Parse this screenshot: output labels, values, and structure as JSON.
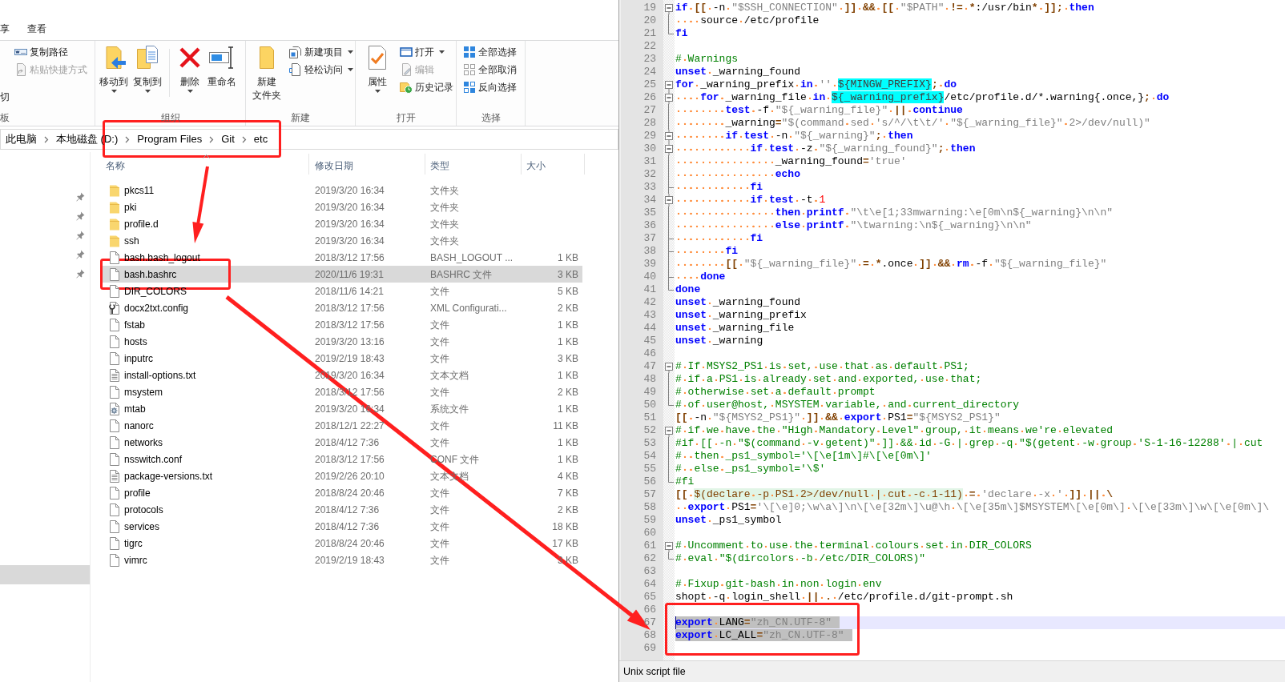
{
  "explorer": {
    "ribbon_tabs": [
      {
        "label": "享",
        "selected": false
      },
      {
        "label": "查看",
        "selected": false
      }
    ],
    "ribbon_groups": [
      {
        "label": "板",
        "columns": [
          [
            {
              "kind": "fragment",
              "label": "切"
            }
          ],
          [
            {
              "kind": "small",
              "label": "复制路径",
              "disabled": false,
              "dropdown": false
            },
            {
              "kind": "small",
              "label": "粘贴快捷方式",
              "disabled": true,
              "dropdown": false
            }
          ]
        ]
      },
      {
        "label": "组织",
        "columns": [
          [
            {
              "kind": "large",
              "label": "移动到",
              "disabled": false,
              "dropdown": true
            }
          ],
          [
            {
              "kind": "large",
              "label": "复制到",
              "disabled": false,
              "dropdown": true
            }
          ],
          [
            {
              "kind": "separator"
            }
          ],
          [
            {
              "kind": "large",
              "label": "删除",
              "disabled": false,
              "dropdown": true
            }
          ],
          [
            {
              "kind": "large",
              "label": "重命名",
              "disabled": false,
              "dropdown": false
            }
          ]
        ]
      },
      {
        "label": "新建",
        "columns": [
          [
            {
              "kind": "large-wrapped",
              "label": "新建文件夹",
              "disabled": false,
              "dropdown": false
            }
          ],
          [
            {
              "kind": "small",
              "label": "新建项目",
              "disabled": false,
              "dropdown": true
            },
            {
              "kind": "small",
              "label": "轻松访问",
              "disabled": false,
              "dropdown": true
            }
          ]
        ]
      },
      {
        "label": "打开",
        "columns": [
          [
            {
              "kind": "large",
              "label": "属性",
              "disabled": false,
              "dropdown": true
            }
          ],
          [
            {
              "kind": "small",
              "label": "打开",
              "disabled": false,
              "dropdown": true
            },
            {
              "kind": "small",
              "label": "编辑",
              "disabled": true,
              "dropdown": false
            },
            {
              "kind": "small",
              "label": "历史记录",
              "disabled": false,
              "dropdown": false
            }
          ]
        ]
      },
      {
        "label": "选择",
        "columns": [
          [
            {
              "kind": "small",
              "label": "全部选择",
              "disabled": false,
              "dropdown": false
            },
            {
              "kind": "small",
              "label": "全部取消",
              "disabled": false,
              "dropdown": false
            },
            {
              "kind": "small",
              "label": "反向选择",
              "disabled": false,
              "dropdown": false
            }
          ]
        ]
      }
    ],
    "address_bar": {
      "path": [
        "此电脑",
        "本地磁盘 (D:)",
        "Program Files",
        "Git",
        "etc"
      ]
    },
    "navigation_pane": {
      "items": [
        {
          "pinned": true,
          "selected": false
        },
        {
          "pinned": true,
          "selected": false
        },
        {
          "pinned": true,
          "selected": false
        },
        {
          "pinned": true,
          "selected": false
        },
        {
          "pinned": true,
          "selected": false
        },
        {
          "pinned": false,
          "selected": true
        }
      ]
    },
    "file_list": {
      "columns": [
        {
          "label": "名称",
          "sorted": true
        },
        {
          "label": "修改日期",
          "sorted": false
        },
        {
          "label": "类型",
          "sorted": false
        },
        {
          "label": "大小",
          "sorted": false
        }
      ],
      "rows": [
        {
          "kind": "folder",
          "name": "pkcs11",
          "modified": "2019/3/20 16:34",
          "type": "文件夹",
          "selected": false
        },
        {
          "kind": "folder",
          "name": "pki",
          "modified": "2019/3/20 16:34",
          "type": "文件夹",
          "selected": false
        },
        {
          "kind": "folder",
          "name": "profile.d",
          "modified": "2019/3/20 16:34",
          "type": "文件夹",
          "selected": false
        },
        {
          "kind": "folder",
          "name": "ssh",
          "modified": "2019/3/20 16:34",
          "type": "文件夹",
          "selected": false
        },
        {
          "kind": "file",
          "name": "bash.bash_logout",
          "modified": "2018/3/12 17:56",
          "type": "BASH_LOGOUT ...",
          "size": "1 KB",
          "selected": false
        },
        {
          "kind": "file",
          "name": "bash.bashrc",
          "modified": "2020/11/6 19:31",
          "type": "BASHRC 文件",
          "size": "3 KB",
          "selected": true
        },
        {
          "kind": "file",
          "name": "DIR_COLORS",
          "modified": "2018/11/6 14:21",
          "type": "文件",
          "size": "5 KB",
          "selected": false
        },
        {
          "kind": "config",
          "name": "docx2txt.config",
          "modified": "2018/3/12 17:56",
          "type": "XML Configurati...",
          "size": "2 KB",
          "selected": false
        },
        {
          "kind": "file",
          "name": "fstab",
          "modified": "2018/3/12 17:56",
          "type": "文件",
          "size": "1 KB",
          "selected": false
        },
        {
          "kind": "file",
          "name": "hosts",
          "modified": "2019/3/20 13:16",
          "type": "文件",
          "size": "1 KB",
          "selected": false
        },
        {
          "kind": "file",
          "name": "inputrc",
          "modified": "2019/2/19 18:43",
          "type": "文件",
          "size": "3 KB",
          "selected": false
        },
        {
          "kind": "text",
          "name": "install-options.txt",
          "modified": "2019/3/20 16:34",
          "type": "文本文档",
          "size": "1 KB",
          "selected": false
        },
        {
          "kind": "file",
          "name": "msystem",
          "modified": "2018/3/12 17:56",
          "type": "文件",
          "size": "2 KB",
          "selected": false
        },
        {
          "kind": "system",
          "name": "mtab",
          "modified": "2019/3/20 16:34",
          "type": "系统文件",
          "size": "1 KB",
          "selected": false
        },
        {
          "kind": "file",
          "name": "nanorc",
          "modified": "2018/12/1 22:27",
          "type": "文件",
          "size": "11 KB",
          "selected": false
        },
        {
          "kind": "file",
          "name": "networks",
          "modified": "2018/4/12 7:36",
          "type": "文件",
          "size": "1 KB",
          "selected": false
        },
        {
          "kind": "file",
          "name": "nsswitch.conf",
          "modified": "2018/3/12 17:56",
          "type": "CONF 文件",
          "size": "1 KB",
          "selected": false
        },
        {
          "kind": "text",
          "name": "package-versions.txt",
          "modified": "2019/2/26 20:10",
          "type": "文本文档",
          "size": "4 KB",
          "selected": false
        },
        {
          "kind": "file",
          "name": "profile",
          "modified": "2018/8/24 20:46",
          "type": "文件",
          "size": "7 KB",
          "selected": false
        },
        {
          "kind": "file",
          "name": "protocols",
          "modified": "2018/4/12 7:36",
          "type": "文件",
          "size": "2 KB",
          "selected": false
        },
        {
          "kind": "file",
          "name": "services",
          "modified": "2018/4/12 7:36",
          "type": "文件",
          "size": "18 KB",
          "selected": false
        },
        {
          "kind": "file",
          "name": "tigrc",
          "modified": "2018/8/24 20:46",
          "type": "文件",
          "size": "17 KB",
          "selected": false
        },
        {
          "kind": "file",
          "name": "vimrc",
          "modified": "2019/2/19 18:43",
          "type": "文件",
          "size": "3 KB",
          "selected": false
        }
      ]
    }
  },
  "editor": {
    "lines": [
      {
        "number": "19",
        "fold": {
          "kind": "open"
        },
        "selected": false,
        "current": false,
        "tokens": [
          {
            "kind": "keyword",
            "text": "if "
          },
          {
            "kind": "operator",
            "text": "[[ "
          },
          {
            "kind": "plain",
            "text": "-n "
          },
          {
            "kind": "string",
            "text": "\"$SSH_CONNECTION\" "
          },
          {
            "kind": "operator",
            "text": "]] && [[ "
          },
          {
            "kind": "string",
            "text": "\"$PATH\" "
          },
          {
            "kind": "operator",
            "text": "!= *"
          },
          {
            "kind": "plain",
            "text": ":/usr/bin"
          },
          {
            "kind": "operator",
            "text": "* ]]; "
          },
          {
            "kind": "keyword",
            "text": "then"
          }
        ]
      },
      {
        "number": "20",
        "fold": {
          "kind": "line"
        },
        "selected": false,
        "current": false,
        "tokens": [
          {
            "kind": "plain",
            "text": "    source /etc/profile"
          }
        ]
      },
      {
        "number": "21",
        "fold": {
          "kind": "end"
        },
        "selected": false,
        "current": false,
        "tokens": [
          {
            "kind": "keyword",
            "text": "fi"
          }
        ]
      },
      {
        "number": "22",
        "selected": false,
        "current": false
      },
      {
        "number": "23",
        "selected": false,
        "current": false,
        "tokens": [
          {
            "kind": "comment",
            "text": "# Warnings"
          }
        ]
      },
      {
        "number": "24",
        "selected": false,
        "current": false,
        "tokens": [
          {
            "kind": "keyword",
            "text": "unset "
          },
          {
            "kind": "plain",
            "text": "_warning_found"
          }
        ]
      },
      {
        "number": "25",
        "fold": {
          "kind": "open"
        },
        "selected": false,
        "current": false,
        "tokens": [
          {
            "kind": "keyword",
            "text": "for "
          },
          {
            "kind": "plain",
            "text": "_warning_prefix "
          },
          {
            "kind": "keyword",
            "text": "in "
          },
          {
            "kind": "string",
            "text": "'' "
          },
          {
            "kind": "param",
            "text": "${MINGW_PREFIX}"
          },
          {
            "kind": "operator",
            "text": "; "
          },
          {
            "kind": "keyword",
            "text": "do"
          }
        ]
      },
      {
        "number": "26",
        "fold": {
          "kind": "nested"
        },
        "selected": false,
        "current": false,
        "tokens": [
          {
            "kind": "keyword",
            "text": "    for "
          },
          {
            "kind": "plain",
            "text": "_warning_file "
          },
          {
            "kind": "keyword",
            "text": "in "
          },
          {
            "kind": "param",
            "text": "${_warning_prefix}"
          },
          {
            "kind": "plain",
            "text": "/etc/profile.d/*.warning{.once,}"
          },
          {
            "kind": "operator",
            "text": "; "
          },
          {
            "kind": "keyword",
            "text": "do"
          }
        ]
      },
      {
        "number": "27",
        "fold": {
          "kind": "line"
        },
        "selected": false,
        "current": false,
        "tokens": [
          {
            "kind": "keyword",
            "text": "        test "
          },
          {
            "kind": "plain",
            "text": "-f "
          },
          {
            "kind": "string",
            "text": "\"${_warning_file}\" "
          },
          {
            "kind": "operator",
            "text": "|| "
          },
          {
            "kind": "keyword",
            "text": "continue"
          }
        ]
      },
      {
        "number": "28",
        "fold": {
          "kind": "line"
        },
        "selected": false,
        "current": false,
        "tokens": [
          {
            "kind": "plain",
            "text": "        _warning"
          },
          {
            "kind": "operator",
            "text": "="
          },
          {
            "kind": "string",
            "text": "\"$(command sed 's/^/\\t\\t/' \"${_warning_file}\" 2>/dev/null)\""
          }
        ]
      },
      {
        "number": "29",
        "fold": {
          "kind": "nested"
        },
        "selected": false,
        "current": false,
        "tokens": [
          {
            "kind": "keyword",
            "text": "        if test "
          },
          {
            "kind": "plain",
            "text": "-n "
          },
          {
            "kind": "string",
            "text": "\"${_warning}\""
          },
          {
            "kind": "operator",
            "text": "; "
          },
          {
            "kind": "keyword",
            "text": "then"
          }
        ]
      },
      {
        "number": "30",
        "fold": {
          "kind": "nested"
        },
        "selected": false,
        "current": false,
        "tokens": [
          {
            "kind": "keyword",
            "text": "            if test "
          },
          {
            "kind": "plain",
            "text": "-z "
          },
          {
            "kind": "string",
            "text": "\"${_warning_found}\""
          },
          {
            "kind": "operator",
            "text": "; "
          },
          {
            "kind": "keyword",
            "text": "then"
          }
        ]
      },
      {
        "number": "31",
        "fold": {
          "kind": "line"
        },
        "selected": false,
        "current": false,
        "tokens": [
          {
            "kind": "plain",
            "text": "                _warning_found"
          },
          {
            "kind": "operator",
            "text": "="
          },
          {
            "kind": "string",
            "text": "'true'"
          }
        ]
      },
      {
        "number": "32",
        "fold": {
          "kind": "line"
        },
        "selected": false,
        "current": false,
        "tokens": [
          {
            "kind": "keyword",
            "text": "                echo"
          }
        ]
      },
      {
        "number": "33",
        "fold": {
          "kind": "tee"
        },
        "selected": false,
        "current": false,
        "tokens": [
          {
            "kind": "keyword",
            "text": "            fi"
          }
        ]
      },
      {
        "number": "34",
        "fold": {
          "kind": "nested"
        },
        "selected": false,
        "current": false,
        "tokens": [
          {
            "kind": "keyword",
            "text": "            if test "
          },
          {
            "kind": "plain",
            "text": "-t "
          },
          {
            "kind": "number",
            "text": "1"
          }
        ]
      },
      {
        "number": "35",
        "fold": {
          "kind": "line"
        },
        "selected": false,
        "current": false,
        "tokens": [
          {
            "kind": "keyword",
            "text": "                then printf "
          },
          {
            "kind": "string",
            "text": "\"\\t\\e[1;33mwarning:\\e[0m\\n${_warning}\\n\\n\""
          }
        ]
      },
      {
        "number": "36",
        "fold": {
          "kind": "line"
        },
        "selected": false,
        "current": false,
        "tokens": [
          {
            "kind": "keyword",
            "text": "                else printf "
          },
          {
            "kind": "string",
            "text": "\"\\twarning:\\n${_warning}\\n\\n\""
          }
        ]
      },
      {
        "number": "37",
        "fold": {
          "kind": "tee"
        },
        "selected": false,
        "current": false,
        "tokens": [
          {
            "kind": "keyword",
            "text": "            fi"
          }
        ]
      },
      {
        "number": "38",
        "fold": {
          "kind": "tee"
        },
        "selected": false,
        "current": false,
        "tokens": [
          {
            "kind": "keyword",
            "text": "        fi"
          }
        ]
      },
      {
        "number": "39",
        "fold": {
          "kind": "line"
        },
        "selected": false,
        "current": false,
        "tokens": [
          {
            "kind": "operator",
            "text": "        [[ "
          },
          {
            "kind": "string",
            "text": "\"${_warning_file}\" "
          },
          {
            "kind": "operator",
            "text": "= *"
          },
          {
            "kind": "plain",
            "text": ".once "
          },
          {
            "kind": "operator",
            "text": "]] && "
          },
          {
            "kind": "keyword",
            "text": "rm "
          },
          {
            "kind": "plain",
            "text": "-f "
          },
          {
            "kind": "string",
            "text": "\"${_warning_file}\""
          }
        ]
      },
      {
        "number": "40",
        "fold": {
          "kind": "tee"
        },
        "selected": false,
        "current": false,
        "tokens": [
          {
            "kind": "keyword",
            "text": "    done"
          }
        ]
      },
      {
        "number": "41",
        "fold": {
          "kind": "end"
        },
        "selected": false,
        "current": false,
        "tokens": [
          {
            "kind": "keyword",
            "text": "done"
          }
        ]
      },
      {
        "number": "42",
        "selected": false,
        "current": false,
        "tokens": [
          {
            "kind": "keyword",
            "text": "unset "
          },
          {
            "kind": "plain",
            "text": "_warning_found"
          }
        ]
      },
      {
        "number": "43",
        "selected": false,
        "current": false,
        "tokens": [
          {
            "kind": "keyword",
            "text": "unset "
          },
          {
            "kind": "plain",
            "text": "_warning_prefix"
          }
        ]
      },
      {
        "number": "44",
        "selected": false,
        "current": false,
        "tokens": [
          {
            "kind": "keyword",
            "text": "unset "
          },
          {
            "kind": "plain",
            "text": "_warning_file"
          }
        ]
      },
      {
        "number": "45",
        "selected": false,
        "current": false,
        "tokens": [
          {
            "kind": "keyword",
            "text": "unset "
          },
          {
            "kind": "plain",
            "text": "_warning"
          }
        ]
      },
      {
        "number": "46",
        "selected": false,
        "current": false
      },
      {
        "number": "47",
        "fold": {
          "kind": "open"
        },
        "selected": false,
        "current": false,
        "tokens": [
          {
            "kind": "comment",
            "text": "# If MSYS2_PS1 is set, use that as default PS1;"
          }
        ]
      },
      {
        "number": "48",
        "fold": {
          "kind": "line"
        },
        "selected": false,
        "current": false,
        "tokens": [
          {
            "kind": "comment",
            "text": "# if a PS1 is already set and exported, use that;"
          }
        ]
      },
      {
        "number": "49",
        "fold": {
          "kind": "line"
        },
        "selected": false,
        "current": false,
        "tokens": [
          {
            "kind": "comment",
            "text": "# otherwise set a default prompt"
          }
        ]
      },
      {
        "number": "50",
        "fold": {
          "kind": "end"
        },
        "selected": false,
        "current": false,
        "tokens": [
          {
            "kind": "comment",
            "text": "# of user@host, MSYSTEM variable, and current_directory"
          }
        ]
      },
      {
        "number": "51",
        "selected": false,
        "current": false,
        "tokens": [
          {
            "kind": "operator",
            "text": "[[ "
          },
          {
            "kind": "plain",
            "text": "-n "
          },
          {
            "kind": "string",
            "text": "\"${MSYS2_PS1}\" "
          },
          {
            "kind": "operator",
            "text": "]] && "
          },
          {
            "kind": "keyword",
            "text": "export "
          },
          {
            "kind": "plain",
            "text": "PS1"
          },
          {
            "kind": "operator",
            "text": "="
          },
          {
            "kind": "string",
            "text": "\"${MSYS2_PS1}\""
          }
        ]
      },
      {
        "number": "52",
        "fold": {
          "kind": "open"
        },
        "selected": false,
        "current": false,
        "tokens": [
          {
            "kind": "comment",
            "text": "# if we have the \"High Mandatory Level\" group, it means we're elevated"
          }
        ]
      },
      {
        "number": "53",
        "fold": {
          "kind": "line"
        },
        "selected": false,
        "current": false,
        "tokens": [
          {
            "kind": "comment",
            "text": "#if [[ -n \"$(command -v getent)\" ]] && id -G | grep -q \"$(getent -w group 'S-1-16-12288' | cut"
          }
        ]
      },
      {
        "number": "54",
        "fold": {
          "kind": "line"
        },
        "selected": false,
        "current": false,
        "tokens": [
          {
            "kind": "comment",
            "text": "#  then _ps1_symbol='\\[\\e[1m\\]#\\[\\e[0m\\]'"
          }
        ]
      },
      {
        "number": "55",
        "fold": {
          "kind": "line"
        },
        "selected": false,
        "current": false,
        "tokens": [
          {
            "kind": "comment",
            "text": "#  else _ps1_symbol='\\$'"
          }
        ]
      },
      {
        "number": "56",
        "fold": {
          "kind": "end"
        },
        "selected": false,
        "current": false,
        "tokens": [
          {
            "kind": "comment",
            "text": "#fi"
          }
        ]
      },
      {
        "number": "57",
        "selected": false,
        "current": false,
        "tokens": [
          {
            "kind": "operator",
            "text": "[[ "
          },
          {
            "kind": "subst",
            "text": "$(declare -p PS1 2>/dev/null | cut -c 1-11)"
          },
          {
            "kind": "operator",
            "text": " = "
          },
          {
            "kind": "string",
            "text": "'declare -x ' "
          },
          {
            "kind": "operator",
            "text": "]] || \\"
          }
        ]
      },
      {
        "number": "58",
        "selected": false,
        "current": false,
        "tokens": [
          {
            "kind": "keyword",
            "text": "  export "
          },
          {
            "kind": "plain",
            "text": "PS1"
          },
          {
            "kind": "operator",
            "text": "="
          },
          {
            "kind": "string",
            "text": "'\\[\\e]0;\\w\\a\\]\\n\\[\\e[32m\\]\\u@\\h \\[\\e[35m\\]$MSYSTEM\\[\\e[0m\\] \\[\\e[33m\\]\\w\\[\\e[0m\\]\\"
          }
        ]
      },
      {
        "number": "59",
        "selected": false,
        "current": false,
        "tokens": [
          {
            "kind": "keyword",
            "text": "unset "
          },
          {
            "kind": "plain",
            "text": "_ps1_symbol"
          }
        ]
      },
      {
        "number": "60",
        "selected": false,
        "current": false
      },
      {
        "number": "61",
        "fold": {
          "kind": "open"
        },
        "selected": false,
        "current": false,
        "tokens": [
          {
            "kind": "comment",
            "text": "# Uncomment to use the terminal colours set in DIR_COLORS"
          }
        ]
      },
      {
        "number": "62",
        "fold": {
          "kind": "end"
        },
        "selected": false,
        "current": false,
        "tokens": [
          {
            "kind": "comment",
            "text": "# eval \"$(dircolors -b /etc/DIR_COLORS)\""
          }
        ]
      },
      {
        "number": "63",
        "selected": false,
        "current": false
      },
      {
        "number": "64",
        "selected": false,
        "current": false,
        "tokens": [
          {
            "kind": "comment",
            "text": "# Fixup git-bash in non login env"
          }
        ]
      },
      {
        "number": "65",
        "selected": false,
        "current": false,
        "tokens": [
          {
            "kind": "plain",
            "text": "shopt -q login_shell "
          },
          {
            "kind": "operator",
            "text": "|| . "
          },
          {
            "kind": "plain",
            "text": "/etc/profile.d/git-prompt.sh"
          }
        ]
      },
      {
        "number": "66",
        "selected": false,
        "current": false
      },
      {
        "number": "67",
        "selected": true,
        "current": true,
        "tokens": [
          {
            "kind": "keyword",
            "text": "export"
          },
          {
            "kind": "plain",
            "text": " LANG"
          },
          {
            "kind": "operator",
            "text": "="
          },
          {
            "kind": "string",
            "text": "\"zh_CN.UTF-8\""
          }
        ]
      },
      {
        "number": "68",
        "selected": true,
        "current": false,
        "tokens": [
          {
            "kind": "keyword",
            "text": "export"
          },
          {
            "kind": "plain",
            "text": " LC_ALL"
          },
          {
            "kind": "operator",
            "text": "="
          },
          {
            "kind": "string",
            "text": "\"zh_CN.UTF-8\""
          }
        ]
      },
      {
        "number": "69",
        "selected": false,
        "current": false
      }
    ],
    "status_bar": {
      "file_type": "Unix script file"
    }
  }
}
